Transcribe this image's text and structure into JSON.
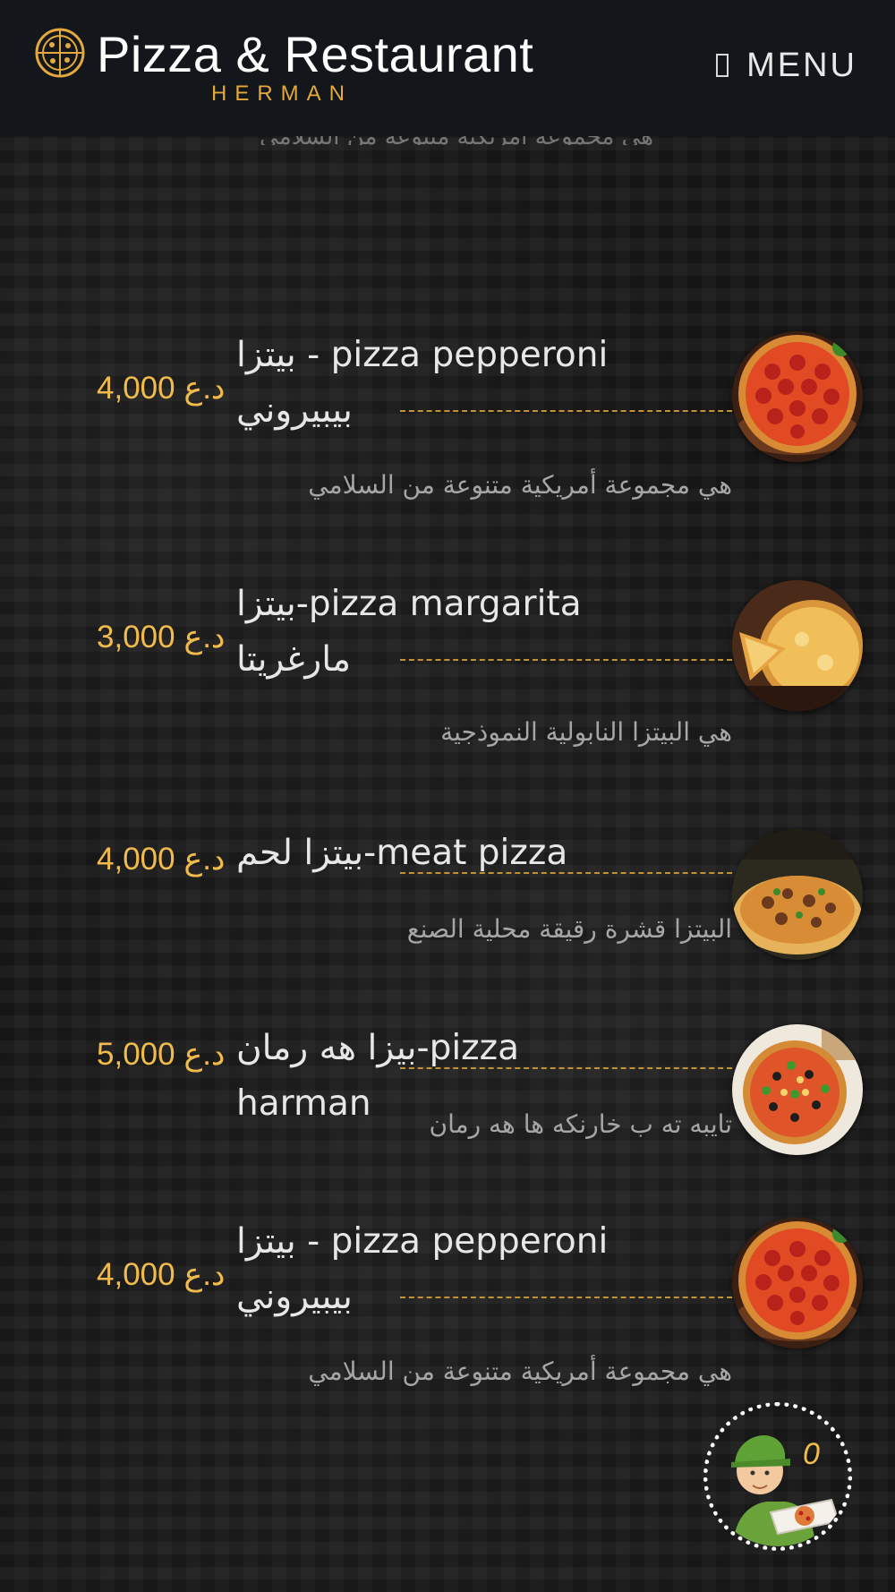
{
  "header": {
    "title": "Pizza & Restaurant",
    "subtitle": "HERMAN",
    "menu_label": "MENU"
  },
  "menu": {
    "cut_off_text": "هي مجموعة أمريكية متنوعة من السلامي",
    "items": [
      {
        "name": "بيتزا - pizza pepperoni بيبيروني",
        "price": "4,000 د.ع",
        "description": "هي مجموعة أمريكية متنوعة من السلامي",
        "image_icon": "pepperoni-pizza-image"
      },
      {
        "name": "بيتزا-pizza margarita مارغريتا",
        "price": "3,000 د.ع",
        "description": "هي البيتزا النابولية النموذجية",
        "image_icon": "margarita-pizza-image"
      },
      {
        "name": "بيتزا لحم-meat pizza",
        "price": "4,000 د.ع",
        "description": "البيتزا قشرة رقيقة محلية الصنع",
        "image_icon": "meat-pizza-image"
      },
      {
        "name": "بيزا هه رمان-pizza harman",
        "price": "5,000 د.ع",
        "description": "تايبه ته ب خارنكه ها هه رمان",
        "image_icon": "harman-pizza-image"
      },
      {
        "name": "بيتزا - pizza pepperoni بيبيروني",
        "price": "4,000 د.ع",
        "description": "هي مجموعة أمريكية متنوعة من السلامي",
        "image_icon": "pepperoni-pizza-image"
      }
    ]
  },
  "cart": {
    "count": "0",
    "icon": "delivery-man-icon"
  },
  "colors": {
    "accent": "#f2bc4d",
    "header_bg": "#13161a",
    "leader": "#c4922e"
  }
}
